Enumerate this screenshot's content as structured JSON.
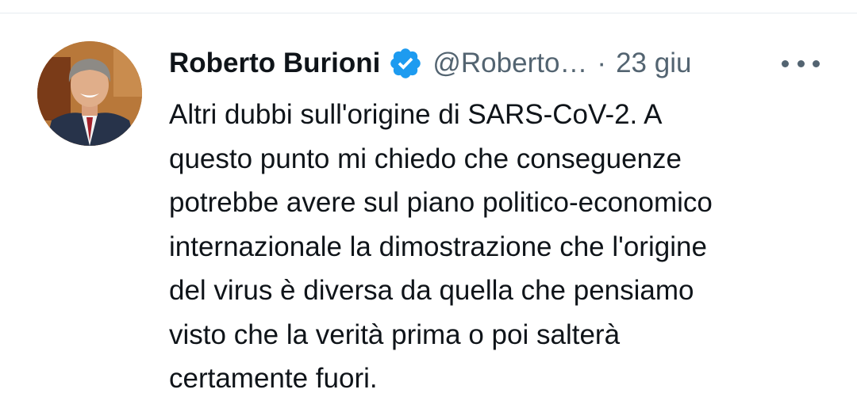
{
  "tweet": {
    "author_name": "Roberto Burioni",
    "handle": "@Roberto…",
    "separator": "·",
    "date": "23 giu",
    "text": "Altri dubbi sull'origine di SARS-CoV-2. A\nquesto punto mi chiedo che conseguenze\npotrebbe avere sul piano politico-economico\ninternazionale la dimostrazione che l'origine\ndel virus è diversa da quella che pensiamo\nvisto che la verità prima o poi salterà\ncertamente fuori.",
    "verified_icon": "verified-badge-icon",
    "more_icon": "more-options-icon"
  },
  "colors": {
    "text_primary": "#0f1419",
    "text_secondary": "#536471",
    "verified_blue": "#1d9bf0",
    "divider": "#e6ecf0"
  }
}
